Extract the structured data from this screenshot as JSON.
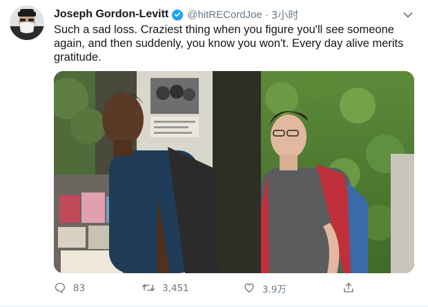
{
  "tweet": {
    "author_name": "Joseph Gordon-Levitt",
    "handle": "@hitRECordJoe",
    "separator": "·",
    "time": "3小时",
    "text": "Such a sad loss. Craziest thing when you figure you'll see someone again, and then suddenly, you know you won't. Every day alive merits gratitude."
  },
  "actions": {
    "reply_count": "83",
    "retweet_count": "3,451",
    "like_count": "3.9万"
  },
  "colors": {
    "verified": "#1da1f2",
    "muted": "#657786",
    "text": "#14171a"
  },
  "icons": [
    "avatar",
    "verified-badge-icon",
    "chevron-down-icon",
    "reply-icon",
    "retweet-icon",
    "like-icon",
    "share-icon"
  ]
}
